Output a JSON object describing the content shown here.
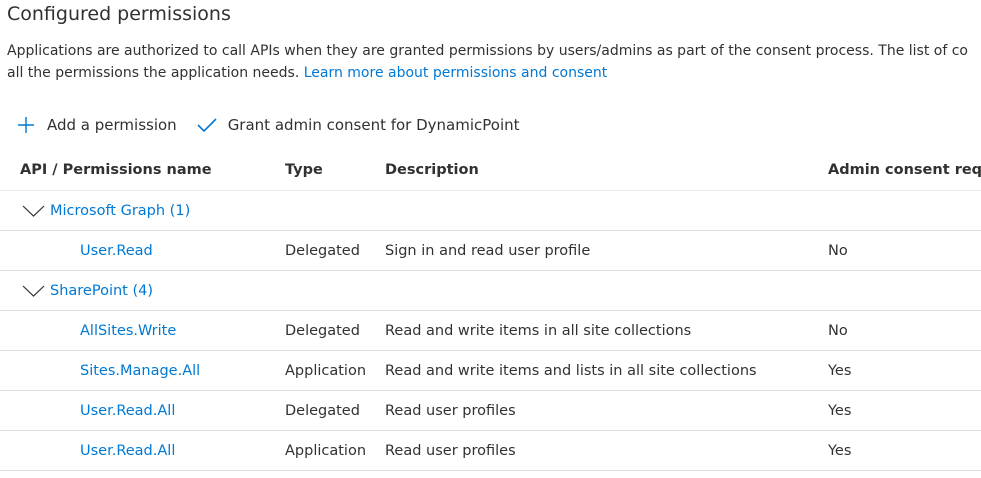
{
  "header": {
    "title": "Configured permissions",
    "description_line1": "Applications are authorized to call APIs when they are granted permissions by users/admins as part of the consent process. The list of co",
    "description_line2": "all the permissions the application needs.",
    "learn_more_link": "Learn more about permissions and consent"
  },
  "toolbar": {
    "add_label": "Add a permission",
    "grant_label": "Grant admin consent for DynamicPoint"
  },
  "table": {
    "columns": {
      "name": "API / Permissions name",
      "type": "Type",
      "description": "Description",
      "admin": "Admin consent requ."
    },
    "groups": [
      {
        "label": "Microsoft Graph (1)",
        "rows": [
          {
            "name": "User.Read",
            "type": "Delegated",
            "description": "Sign in and read user profile",
            "admin": "No"
          }
        ]
      },
      {
        "label": "SharePoint (4)",
        "rows": [
          {
            "name": "AllSites.Write",
            "type": "Delegated",
            "description": "Read and write items in all site collections",
            "admin": "No"
          },
          {
            "name": "Sites.Manage.All",
            "type": "Application",
            "description": "Read and write items and lists in all site collections",
            "admin": "Yes"
          },
          {
            "name": "User.Read.All",
            "type": "Delegated",
            "description": "Read user profiles",
            "admin": "Yes"
          },
          {
            "name": "User.Read.All",
            "type": "Application",
            "description": "Read user profiles",
            "admin": "Yes"
          }
        ]
      }
    ]
  },
  "colors": {
    "link": "#0078d4",
    "text": "#323130",
    "divider": "#e1dfdd"
  },
  "icons": {
    "add": "plus-icon",
    "grant": "checkmark-icon",
    "group_toggle": "chevron-down-icon"
  }
}
